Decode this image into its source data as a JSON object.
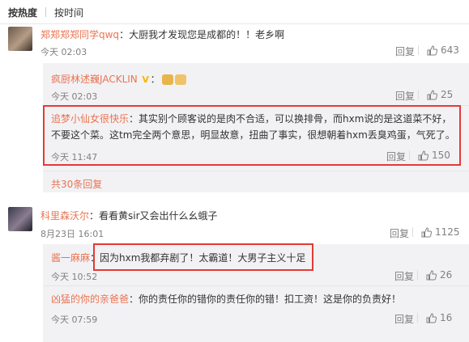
{
  "tabs": {
    "hot": "按热度",
    "time": "按时间"
  },
  "c1": {
    "user": "郑郑郑郑同学qwq",
    "text": "：大厨我才发现您是成都的！！老乡啊",
    "time": "今天 02:03",
    "reply_label": "回复",
    "likes": "643",
    "replies": [
      {
        "user": "疯厨林述巍JACKLIN",
        "text": "：",
        "time": "今天 02:03",
        "likes": "25"
      },
      {
        "user": "追梦小仙女很快乐",
        "text": "：其实别个顾客说的是肉不合适，可以换排骨，而hxm说的是这道菜不好，",
        "text2": "不要这个菜。这tm完全两个意思，明显故意，扭曲了事实，很想朝着hxm丢臭鸡蛋，气死了。",
        "time": "今天 11:47",
        "likes": "150"
      }
    ],
    "more": "共30条回复"
  },
  "c2": {
    "user": "科里森沃尔",
    "text": "：看看黄sir又会出什么幺蛾子",
    "time": "8月23日 16:01",
    "reply_label": "回复",
    "likes": "1125",
    "replies": [
      {
        "user": "酱一麻麻",
        "text": "：因为hxm我都弃剧了！太霸道！大男子主义十足",
        "time": "今天 10:52",
        "likes": "26"
      },
      {
        "user": "凶猛的你的亲爸爸",
        "text": "：你的责任你的错你的责任你的错！扣工资！这是你的负责好！",
        "time": "今天 07:59",
        "likes": "16"
      }
    ]
  },
  "colors": {
    "username": "#eb7350",
    "highlight": "#e53935",
    "reply_bg": "#f2f2f5"
  },
  "icons": {
    "like": "thumbs-up-icon",
    "vip": "v-badge-icon",
    "emoji": "emoji-icon"
  }
}
